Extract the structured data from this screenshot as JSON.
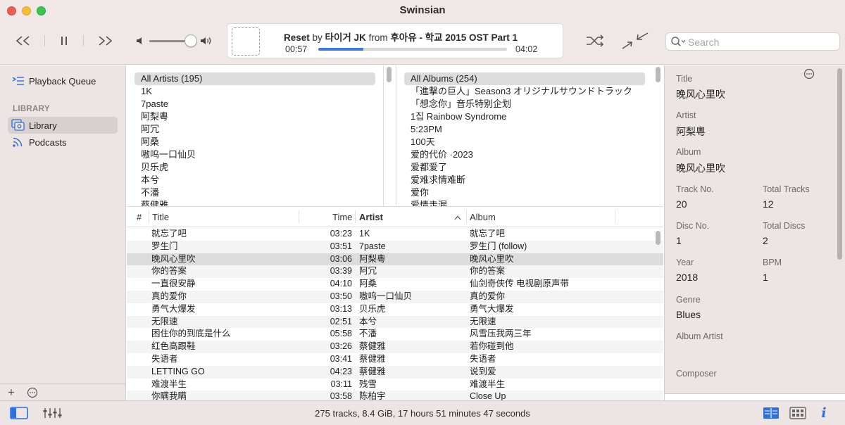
{
  "window": {
    "title": "Swinsian"
  },
  "toolbar": {
    "prev_icon": "rewind-icon",
    "pause_icon": "pause-icon",
    "next_icon": "fast-forward-icon",
    "shuffle_icon": "shuffle-icon",
    "miniplayer_icon": "collapse-arrows-icon",
    "search_placeholder": "Search"
  },
  "now_playing": {
    "track": "Reset",
    "by_word": "by",
    "artist": "타이거 JK",
    "from_word": "from",
    "album": "후아유 - 학교 2015 OST Part 1",
    "elapsed": "00:57",
    "total": "04:02",
    "progress": 0.24,
    "volume": 0.85
  },
  "sidebar": {
    "playback_queue": "Playback Queue",
    "section_label": "LIBRARY",
    "items": [
      {
        "label": "Library",
        "icon": "library-icon",
        "selected": true
      },
      {
        "label": "Podcasts",
        "icon": "podcast-icon",
        "selected": false
      }
    ]
  },
  "artists_pane": {
    "header": "All Artists (195)",
    "items": [
      "1K",
      "7paste",
      "阿梨粵",
      "阿冗",
      "阿桑",
      "嗷呜一口仙贝",
      "贝乐虎",
      "本兮",
      "不潘",
      "蔡健雅"
    ]
  },
  "albums_pane": {
    "header": "All Albums (254)",
    "items": [
      "「進撃の巨人」Season3 オリジナルサウンドトラック",
      "「想念你」音乐特别企划",
      "1집 Rainbow Syndrome",
      "5:23PM",
      "100天",
      "爱的代价 ·2023",
      "爱都爱了",
      "爱难求情难断",
      "爱你",
      "爱情走漏"
    ]
  },
  "table": {
    "columns": {
      "num": "#",
      "title": "Title",
      "time": "Time",
      "artist": "Artist",
      "album": "Album"
    },
    "sort_column": "Artist",
    "rows": [
      {
        "title": "就忘了吧",
        "time": "03:23",
        "artist": "1K",
        "album": "就忘了吧"
      },
      {
        "title": "罗生门",
        "time": "03:51",
        "artist": "7paste",
        "album": "罗生门 (follow)"
      },
      {
        "title": "晚风心里吹",
        "time": "03:06",
        "artist": "阿梨粵",
        "album": "晚风心里吹",
        "selected": true
      },
      {
        "title": "你的答案",
        "time": "03:39",
        "artist": "阿冗",
        "album": "你的答案"
      },
      {
        "title": "一直很安静",
        "time": "04:10",
        "artist": "阿桑",
        "album": "仙剑奇侠传 电视剧原声带"
      },
      {
        "title": "真的爱你",
        "time": "03:50",
        "artist": "嗷呜一口仙贝",
        "album": "真的爱你"
      },
      {
        "title": "勇气大爆发",
        "time": "03:13",
        "artist": "贝乐虎",
        "album": "勇气大爆发"
      },
      {
        "title": "无限速",
        "time": "02:51",
        "artist": "本兮",
        "album": "无限速"
      },
      {
        "title": "困住你的到底是什么",
        "time": "05:58",
        "artist": "不潘",
        "album": "风雪压我两三年"
      },
      {
        "title": "红色高跟鞋",
        "time": "03:26",
        "artist": "蔡健雅",
        "album": "若你碰到他"
      },
      {
        "title": "失语者",
        "time": "03:41",
        "artist": "蔡健雅",
        "album": "失语者"
      },
      {
        "title": "LETTING GO",
        "time": "04:23",
        "artist": "蔡健雅",
        "album": "说到爱"
      },
      {
        "title": "难渡半生",
        "time": "03:11",
        "artist": "残雪",
        "album": "难渡半生"
      },
      {
        "title": "你瞒我瞒",
        "time": "03:58",
        "artist": "陈柏宇",
        "album": "Close Up"
      }
    ]
  },
  "inspector": {
    "title_label": "Title",
    "title_value": "晚风心里吹",
    "artist_label": "Artist",
    "artist_value": "阿梨粵",
    "album_label": "Album",
    "album_value": "晚风心里吹",
    "trackno_label": "Track No.",
    "trackno_value": "20",
    "totaltracks_label": "Total Tracks",
    "totaltracks_value": "12",
    "discno_label": "Disc No.",
    "discno_value": "1",
    "totaldiscs_label": "Total Discs",
    "totaldiscs_value": "2",
    "year_label": "Year",
    "year_value": "2018",
    "bpm_label": "BPM",
    "bpm_value": "1",
    "genre_label": "Genre",
    "genre_value": "Blues",
    "albumartist_label": "Album Artist",
    "composer_label": "Composer"
  },
  "status": {
    "summary": "275 tracks,  8.4 GiB,  17 hours 51 minutes 47 seconds"
  },
  "colors": {
    "accent": "#3d7be0",
    "sidebar_bg": "#ece5e3",
    "toolbar_bg": "#f0e8e6"
  }
}
